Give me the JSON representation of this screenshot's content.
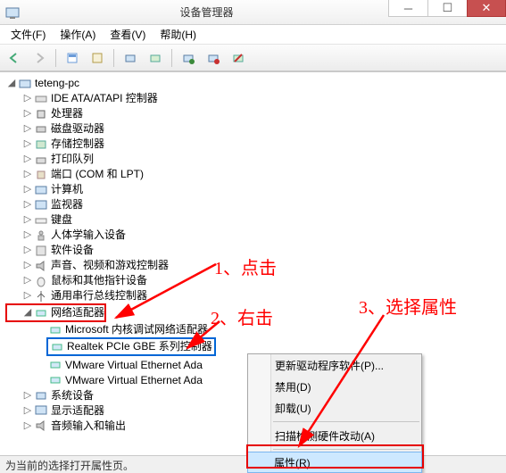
{
  "window": {
    "title": "设备管理器"
  },
  "menu": {
    "file": "文件(F)",
    "action": "操作(A)",
    "view": "查看(V)",
    "help": "帮助(H)"
  },
  "toolbar_icons": {
    "back": "back-icon",
    "fwd": "forward-icon",
    "up": "up-icon",
    "props": "properties-icon",
    "refresh": "refresh-icon",
    "scan": "scan-icon",
    "uninst": "uninstall-icon",
    "enable": "enable-icon",
    "disable": "disable-icon"
  },
  "tree": {
    "root": "teteng-pc",
    "items": [
      "IDE ATA/ATAPI 控制器",
      "处理器",
      "磁盘驱动器",
      "存储控制器",
      "打印队列",
      "端口 (COM 和 LPT)",
      "计算机",
      "监视器",
      "键盘",
      "人体学输入设备",
      "软件设备",
      "声音、视频和游戏控制器",
      "鼠标和其他指针设备",
      "通用串行总线控制器"
    ],
    "network": {
      "label": "网络适配器",
      "children": [
        "Microsoft 内核调试网络适配器",
        "Realtek PCIe GBE 系列控制器",
        "VMware Virtual Ethernet Ada",
        "VMware Virtual Ethernet Ada"
      ]
    },
    "after": [
      "系统设备",
      "显示适配器",
      "音频输入和输出"
    ]
  },
  "context_menu": {
    "update": "更新驱动程序软件(P)...",
    "disable": "禁用(D)",
    "uninstall": "卸载(U)",
    "scan": "扫描检测硬件改动(A)",
    "properties": "属性(R)"
  },
  "status": "为当前的选择打开属性页。",
  "annotations": {
    "a1": "1、点击",
    "a2": "2、右击",
    "a3": "3、选择属性"
  }
}
